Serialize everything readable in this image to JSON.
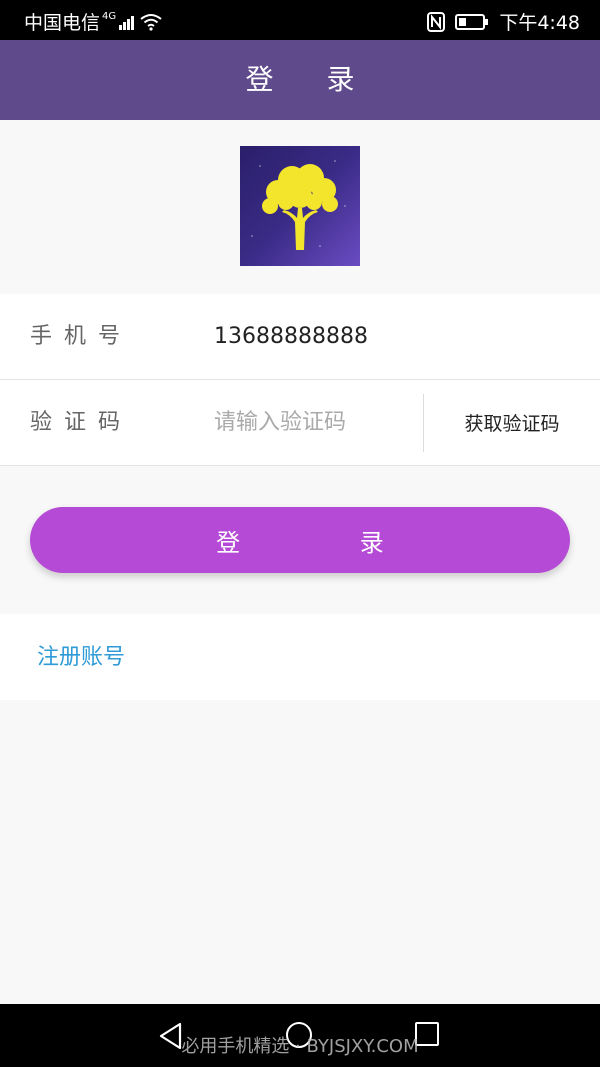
{
  "status_bar": {
    "carrier": "中国电信",
    "network": "4G",
    "time": "下午4:48"
  },
  "header": {
    "title": "登 录"
  },
  "form": {
    "phone_label": "手机号",
    "phone_value": "13688888888",
    "code_label": "验证码",
    "code_placeholder": "请输入验证码",
    "get_code_label": "获取验证码"
  },
  "login_button": {
    "label": "登 录"
  },
  "register": {
    "label": "注册账号"
  },
  "watermark": {
    "text": "必用手机精选 · BYJSJXY.COM"
  },
  "colors": {
    "header_bg": "#5f4a8b",
    "button_bg": "#b54ad6",
    "link": "#2f9bd7",
    "logo_tree": "#f2e52c"
  },
  "icons": [
    "signal-icon",
    "wifi-icon",
    "nfc-icon",
    "battery-icon",
    "tree-logo",
    "back-icon",
    "home-icon",
    "recent-apps-icon"
  ]
}
